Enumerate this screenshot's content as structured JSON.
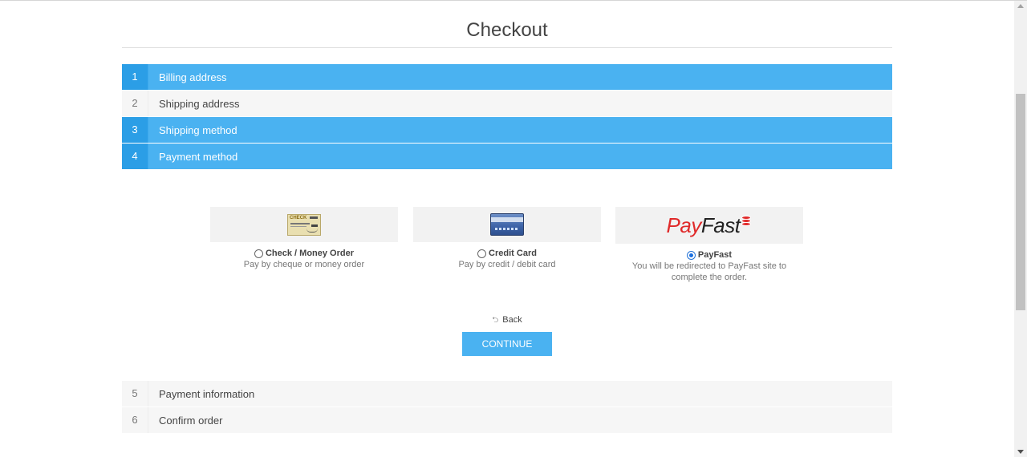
{
  "page": {
    "title": "Checkout"
  },
  "steps_top": [
    {
      "num": "1",
      "label": "Billing address",
      "active": true
    },
    {
      "num": "2",
      "label": "Shipping address",
      "active": false
    },
    {
      "num": "3",
      "label": "Shipping method",
      "active": true
    },
    {
      "num": "4",
      "label": "Payment method",
      "active": true
    }
  ],
  "payment_methods": [
    {
      "name": "Check / Money Order",
      "description": "Pay by cheque or money order",
      "selected": false,
      "logo_icon": "check-icon",
      "logo_text": "CHECK"
    },
    {
      "name": "Credit Card",
      "description": "Pay by credit / debit card",
      "selected": false,
      "logo_icon": "credit-card-icon"
    },
    {
      "name": "PayFast",
      "description": "You will be redirected to PayFast site to complete the order.",
      "selected": true,
      "logo_icon": "payfast-logo",
      "logo_pay": "Pay",
      "logo_fast": "Fast"
    }
  ],
  "actions": {
    "back_label": "Back",
    "back_icon": "undo-arrow-icon",
    "continue_label": "CONTINUE"
  },
  "steps_bottom": [
    {
      "num": "5",
      "label": "Payment information",
      "active": false
    },
    {
      "num": "6",
      "label": "Confirm order",
      "active": false
    }
  ],
  "colors": {
    "accent": "#4ab2f1",
    "accent_dark": "#2b9ee6",
    "step_bg": "#f6f6f6",
    "payfast_red": "#e02a2a"
  }
}
